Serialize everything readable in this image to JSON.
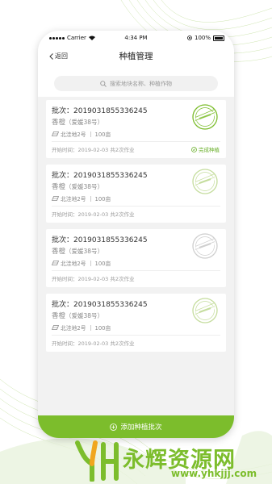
{
  "status_bar": {
    "carrier": "Carrier",
    "time": "4:34 PM",
    "battery": "100%"
  },
  "nav": {
    "back_label": "返回",
    "title": "种植管理"
  },
  "search": {
    "placeholder": "搜索地块名称、种植作物"
  },
  "cards": [
    {
      "batch": "批次：2019031855336245",
      "product": "香橙",
      "variety": "（爱媛38号）",
      "field": "北洼地2号",
      "area": "100亩",
      "start": "开始时间：2019-02-03  共2次作业",
      "status": "完成种植",
      "stamp_color": "#7cbd2c"
    },
    {
      "batch": "批次：2019031855336245",
      "product": "香橙",
      "variety": "（爱媛38号）",
      "field": "北洼地2号",
      "area": "100亩",
      "start": "开始时间：2019-02-03  共2次作业",
      "status": "",
      "stamp_color": "#c5dd9e"
    },
    {
      "batch": "批次：2019031855336245",
      "product": "香橙",
      "variety": "（爱媛38号）",
      "field": "北洼地2号",
      "area": "100亩",
      "start": "开始时间：2019-02-03  共2次作业",
      "status": "",
      "stamp_color": "#cfcfcf"
    },
    {
      "batch": "批次：2019031855336245",
      "product": "香橙",
      "variety": "（爱媛38号）",
      "field": "北洼地2号",
      "area": "100亩",
      "start": "开始时间：2019-02-03  共2次作业",
      "status": "",
      "stamp_color": "#c5dd9e"
    }
  ],
  "add_button_label": "添加种植批次",
  "watermark": {
    "text": "永辉资源网",
    "url": "www.yhkjjj.com"
  },
  "colors": {
    "accent": "#7cbd2c",
    "background": "#f2f2f2"
  }
}
